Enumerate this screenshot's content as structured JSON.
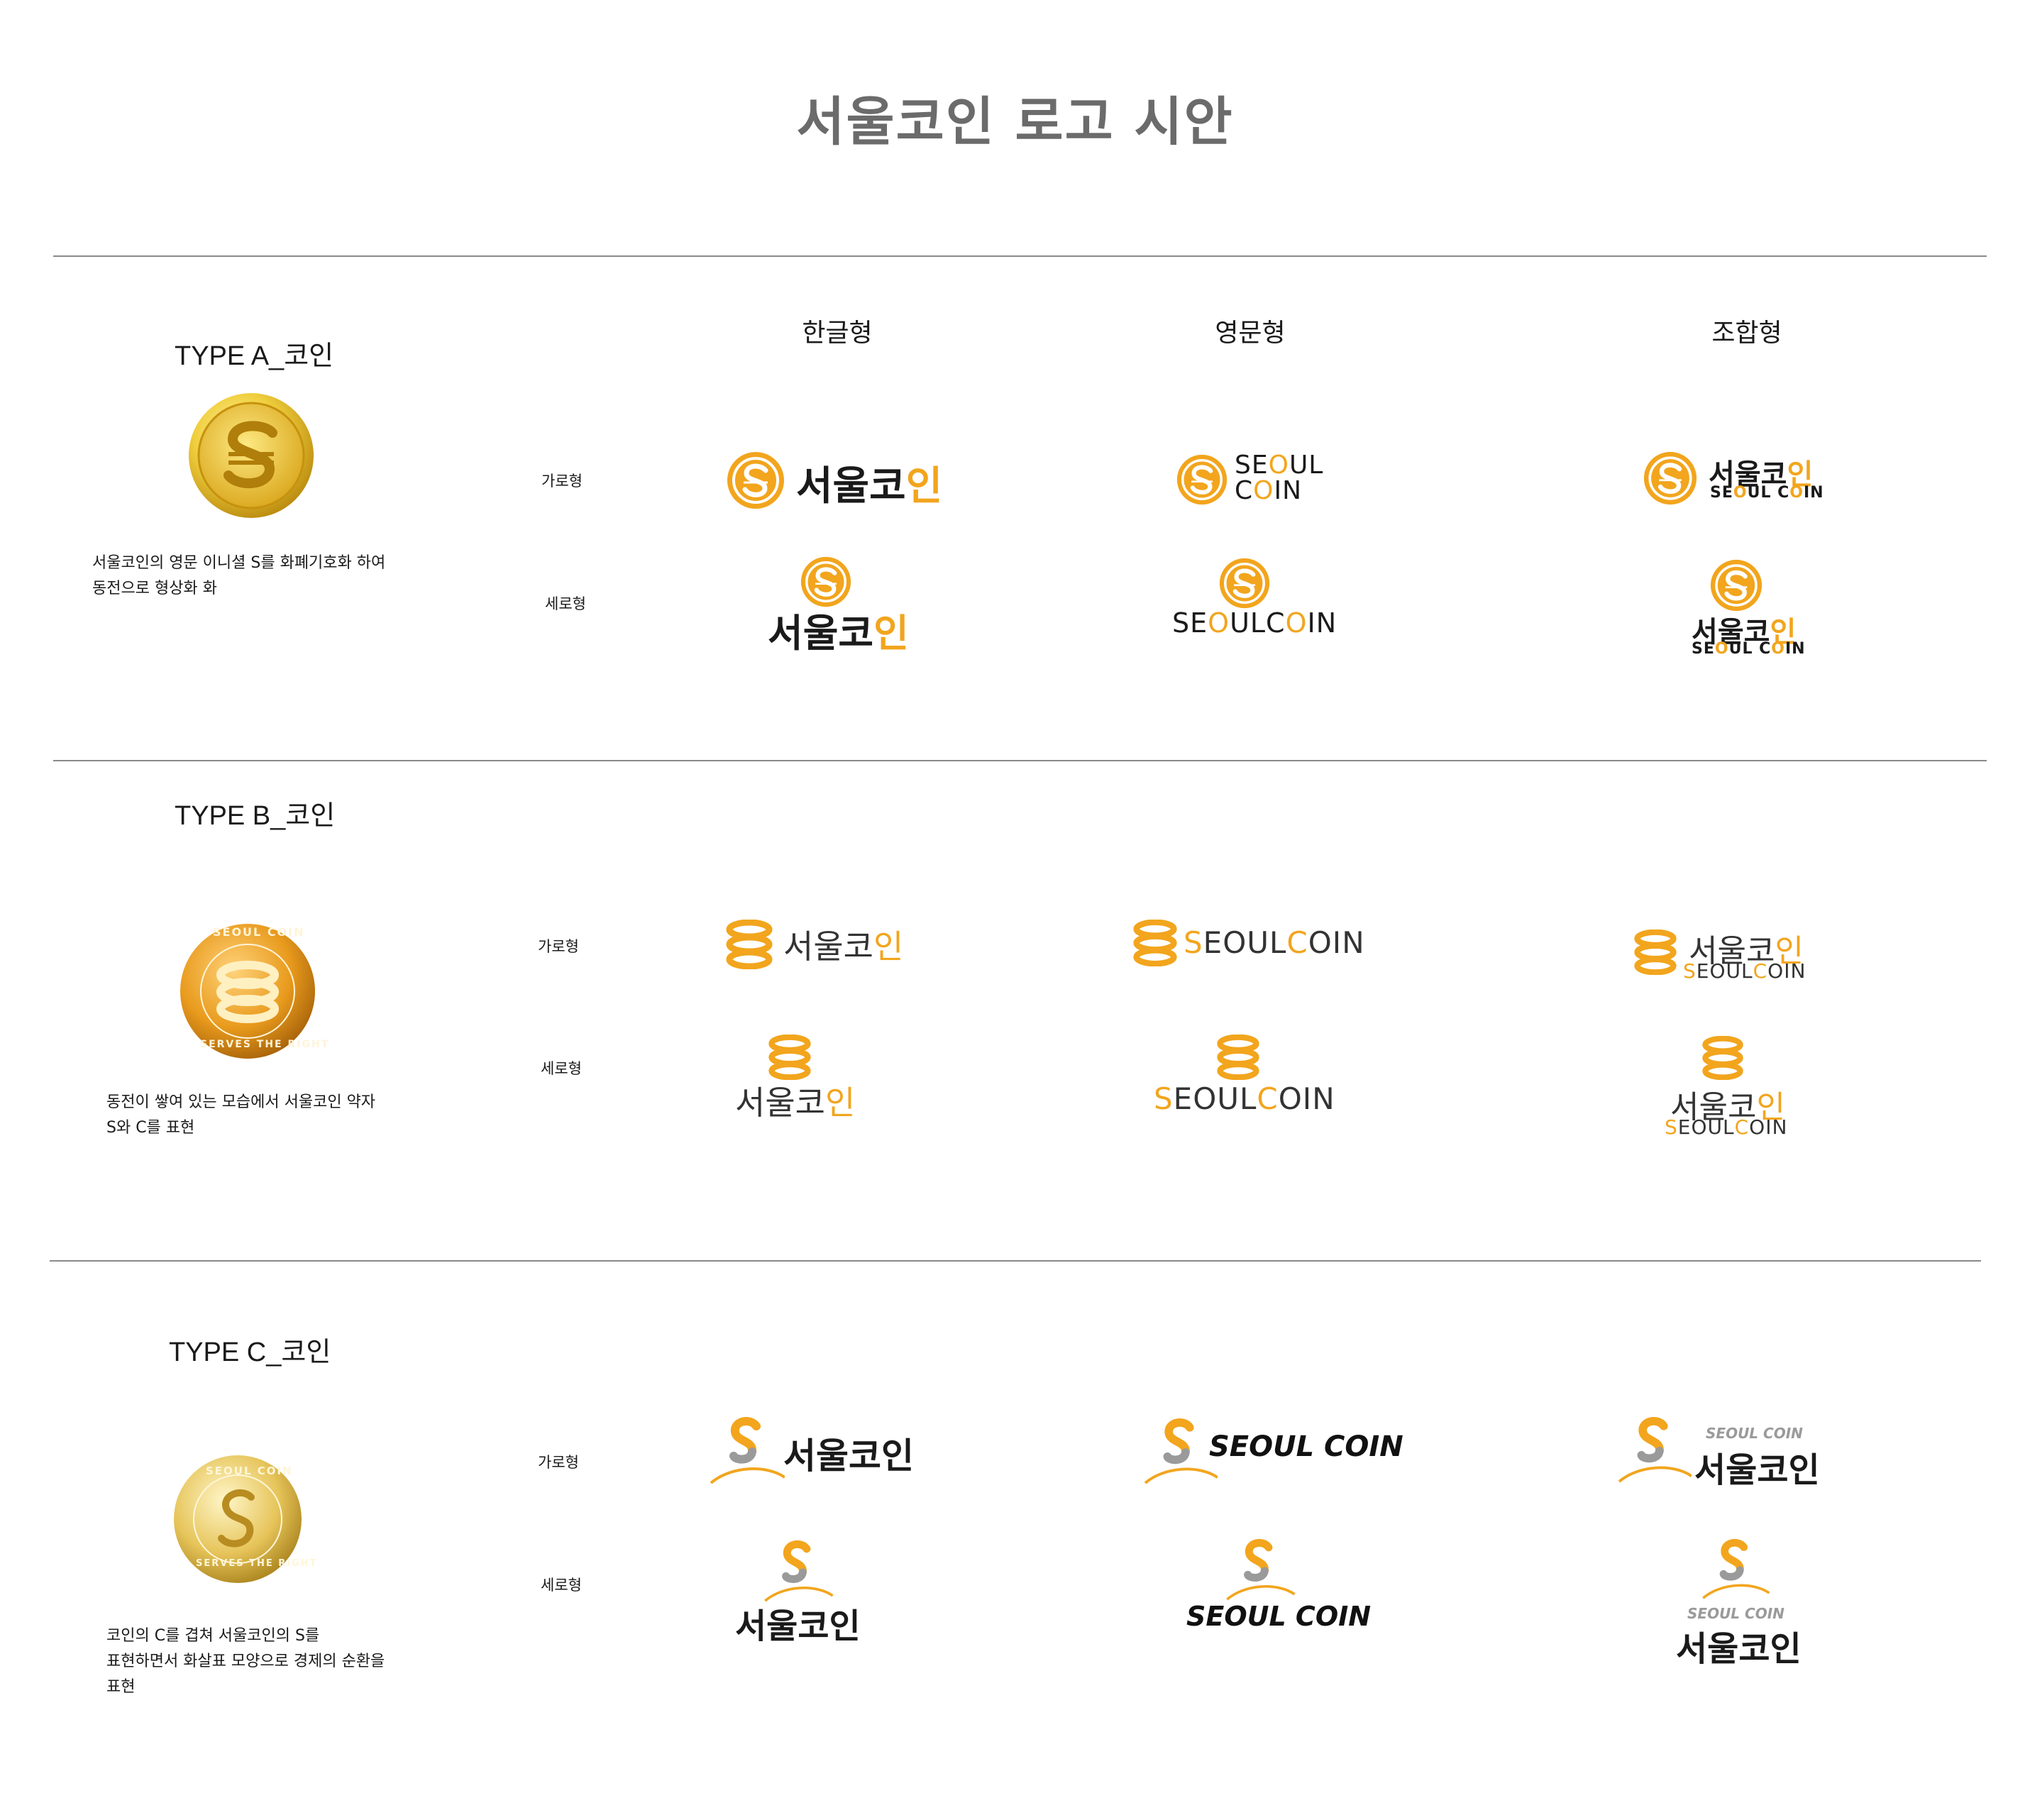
{
  "page": {
    "title": "서울코인 로고 시안",
    "columns": [
      "한글형",
      "영문형",
      "조합형"
    ],
    "row_labels": {
      "horizontal": "가로형",
      "vertical": "세로형"
    }
  },
  "colors": {
    "gold": "#f2a51d",
    "dark": "#1a1a1a",
    "grey": "#9a9a9a",
    "title": "#6b6b6b",
    "rule": "#8a8a8a"
  },
  "types": [
    {
      "label": "TYPE A_코인",
      "description": "서울코인의 영문 이니셜 S를 화폐기호화 하여\n동전으로 형상화 화",
      "icon": "dollar-s-coin-icon"
    },
    {
      "label": "TYPE B_코인",
      "description": "동전이 쌓여 있는 모습에서 서울코인 약자\nS와 C를 표현",
      "icon": "stacked-coin-icon",
      "coin_ring_text": [
        "SEOUL COIN",
        "SERVES THE RIGHT"
      ]
    },
    {
      "label": "TYPE C_코인",
      "description": "코인의 C를 겹쳐 서울코인의 S를\n표현하면서 화살표 모양으로 경제의 순환을\n표현",
      "icon": "arrow-s-coin-icon",
      "coin_ring_text": [
        "SEOUL COIN",
        "SERVES THE RIGHT"
      ]
    }
  ],
  "logo_text": {
    "kor": [
      "서",
      "울",
      "코",
      "인"
    ],
    "eng_top": [
      "SE",
      "O",
      "UL"
    ],
    "eng_bottom": [
      "C",
      "O",
      "IN"
    ],
    "eng_line": [
      "SE",
      "O",
      "UL",
      "C",
      "O",
      "IN"
    ],
    "eng_b": [
      "S",
      "EOUL",
      "C",
      "OIN"
    ],
    "eng_c": "SEOUL COIN",
    "eng_c_small": "SEOUL COIN"
  }
}
